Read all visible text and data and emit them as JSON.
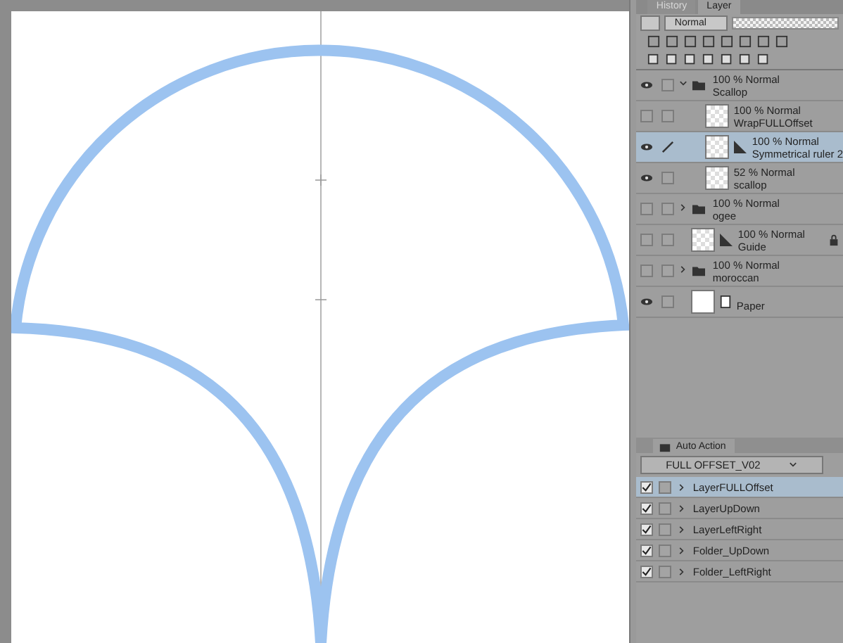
{
  "tabs": [
    {
      "label": "History",
      "selected": false
    },
    {
      "label": "Layer",
      "selected": true
    }
  ],
  "blend_mode": "Normal",
  "opacity": {
    "level": 1
  },
  "layers": [
    {
      "name": "Scallop",
      "info": "100 % Normal",
      "kind": "folder",
      "visible": true,
      "expanded": true,
      "selected": false,
      "locked": false,
      "editing": false,
      "children": [
        {
          "name": "WrapFULLOffset",
          "info": "100 % Normal",
          "kind": "image",
          "visible": false,
          "selected": false,
          "locked": false,
          "editing": false
        },
        {
          "name": "Symmetrical ruler 2",
          "info": "100 % Normal",
          "kind": "ruler",
          "visible": true,
          "selected": true,
          "locked": false,
          "editing": true
        },
        {
          "name": "scallop",
          "info": "52 % Normal",
          "kind": "image",
          "visible": true,
          "selected": false,
          "locked": false,
          "editing": false
        }
      ]
    },
    {
      "name": "ogee",
      "info": "100 % Normal",
      "kind": "folder",
      "visible": false,
      "expanded": false,
      "selected": false,
      "locked": false,
      "editing": false
    },
    {
      "name": "Guide",
      "info": "100 % Normal",
      "kind": "ruler",
      "visible": false,
      "selected": false,
      "locked": true,
      "editing": false
    },
    {
      "name": "moroccan",
      "info": "100 % Normal",
      "kind": "folder",
      "visible": false,
      "expanded": false,
      "selected": false,
      "locked": false,
      "editing": false
    },
    {
      "name": "Paper",
      "kind": "paper",
      "visible": true,
      "selected": false,
      "locked": false,
      "editing": false
    }
  ],
  "auto_action": {
    "title": "Auto Action",
    "action_set": "FULL OFFSET_V02",
    "actions": [
      {
        "name": "LayerFULLOffset",
        "checked": true,
        "selected": true
      },
      {
        "name": "LayerUpDown",
        "checked": true,
        "selected": false
      },
      {
        "name": "LayerLeftRight",
        "checked": true,
        "selected": false
      },
      {
        "name": "Folder_UpDown",
        "checked": true,
        "selected": false
      },
      {
        "name": "Folder_LeftRight",
        "checked": true,
        "selected": false
      }
    ]
  }
}
